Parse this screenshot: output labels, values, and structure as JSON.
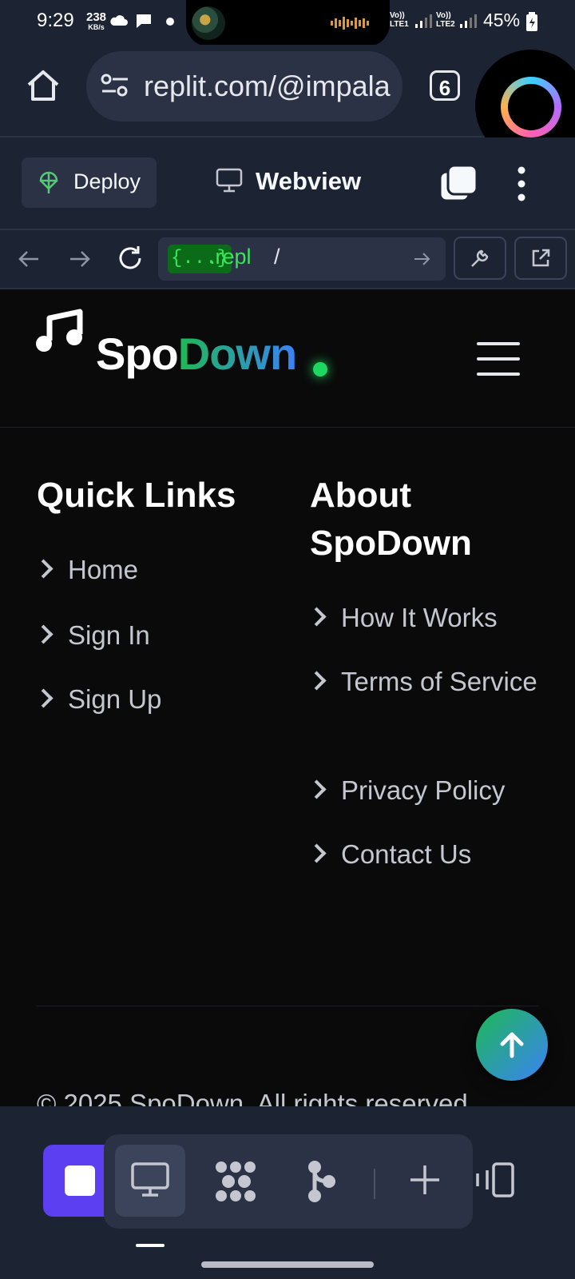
{
  "status_bar": {
    "time": "9:29",
    "speed_value": "238",
    "speed_unit": "KB/s",
    "signal1": "Vo)) LTE1",
    "signal2": "Vo)) LTE2",
    "battery": "45%"
  },
  "browser": {
    "url": "replit.com/@impala",
    "tab_count": "6"
  },
  "replit_toolbar": {
    "deploy_label": "Deploy",
    "webview_label": "Webview"
  },
  "webview_nav": {
    "address_braces": "{...}",
    "address_domain": ".repl",
    "address_path": "/"
  },
  "site": {
    "logo_part1": "Spo",
    "logo_part2": "Down",
    "quick_links": {
      "heading": "Quick Links",
      "items": [
        "Home",
        "Sign In",
        "Sign Up"
      ]
    },
    "about": {
      "heading": "About SpoDown",
      "items": [
        "How It Works",
        "Terms of Service",
        "Privacy Policy",
        "Contact Us"
      ]
    },
    "copyright": "© 2025 SpoDown. All rights reserved."
  },
  "colors": {
    "accent_green": "#1db954",
    "accent_blue": "#3b82f6",
    "stop_purple": "#5b3ff0",
    "replit_bg": "#1c2333"
  }
}
